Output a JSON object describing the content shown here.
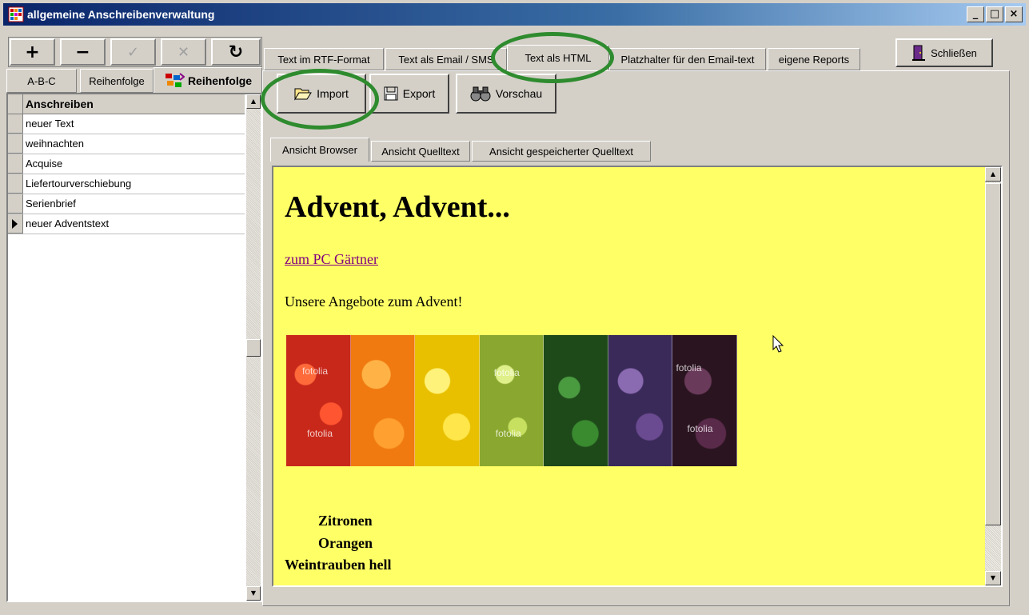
{
  "window": {
    "title": "allgemeine Anschreibenverwaltung",
    "buttons": [
      "_",
      "□",
      "×"
    ]
  },
  "nav_toolbar": {
    "add": "+",
    "remove": "−",
    "post": "✓",
    "cancel": "✕",
    "refresh": "↻"
  },
  "left_tabs": [
    "A-B-C",
    "Reihenfolge",
    "Reihenfolge"
  ],
  "grid": {
    "header": "Anschreiben",
    "rows": [
      "neuer Text",
      "weihnachten",
      "Acquise",
      "Liefertourverschiebung",
      "Serienbrief",
      "neuer Adventstext"
    ],
    "current_row": 5
  },
  "close_button": "Schließen",
  "main_tabs": [
    "Text im RTF-Format",
    "Text als Email / SMS",
    "Text als HTML",
    "Platzhalter für den Email-text",
    "eigene Reports"
  ],
  "selected_main_tab": 2,
  "toolbar": {
    "import": "Import",
    "export": "Export",
    "preview": "Vorschau"
  },
  "sub_tabs": [
    "Ansicht Browser",
    "Ansicht Quelltext",
    "Ansicht gespeicherter Quelltext"
  ],
  "selected_sub_tab": 0,
  "browser": {
    "heading": "Advent, Advent...",
    "link": "zum PC Gärtner",
    "paragraph": "Unsere Angebote zum Advent!",
    "watermark": "fotolia",
    "items": [
      "Zitronen",
      "Orangen",
      "Weintrauben hell"
    ]
  },
  "colors": {
    "browser_background": "#ffff66",
    "highlight_circle": "#2e8b2e",
    "link": "#800080"
  }
}
